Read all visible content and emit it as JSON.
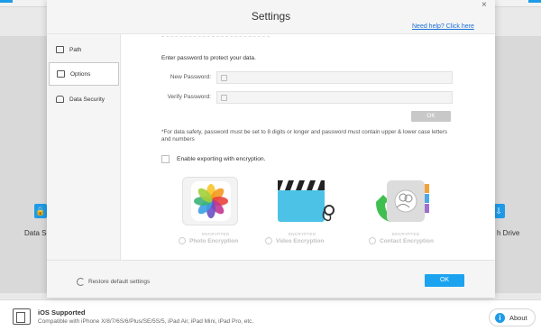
{
  "background_app": {
    "left_feature_label": "Data Se",
    "right_feature_label": "h Drive",
    "footer": {
      "ios_title": "iOS Supported",
      "ios_compat": "Compatible with iPhone X/8/7/6S/6/Plus/SE/5S/5, iPad Air, iPad Mini, iPad Pro, etc.",
      "about_label": "About"
    }
  },
  "dialog": {
    "title": "Settings",
    "help_link": "Need help? Click here",
    "close_glyph": "×",
    "sidebar": [
      {
        "label": "Path",
        "icon": "folder-icon"
      },
      {
        "label": "Options",
        "icon": "options-icon",
        "active": true
      },
      {
        "label": "Data Security",
        "icon": "lock-icon"
      }
    ],
    "security": {
      "intro": "Enter password to protect your data.",
      "new_password_label": "New Password:",
      "verify_password_label": "Verify Password:",
      "new_password_value": "",
      "verify_password_value": "",
      "ok_label": "OK",
      "note": "*For data safety, password must be set to 8 digits or longer and password must contain upper & lower case letters and numbers",
      "enable_export_label": "Enable exporting with encryption.",
      "enable_export_checked": false,
      "options": [
        {
          "tag": "ENCRYPTED",
          "label": "Photo Encryption",
          "icon": "photos-icon"
        },
        {
          "tag": "ENCRYPTED",
          "label": "Video Encryption",
          "icon": "clapperboard-icon"
        },
        {
          "tag": "ENCRYPTED",
          "label": "Contact Encryption",
          "icon": "contacts-icon"
        }
      ]
    },
    "footer": {
      "restore_label": "Restore default settings",
      "ok_label": "OK"
    }
  },
  "colors": {
    "accent": "#1ba3f0",
    "link": "#1a6fd8",
    "disabled_button": "#c8c8c8"
  }
}
